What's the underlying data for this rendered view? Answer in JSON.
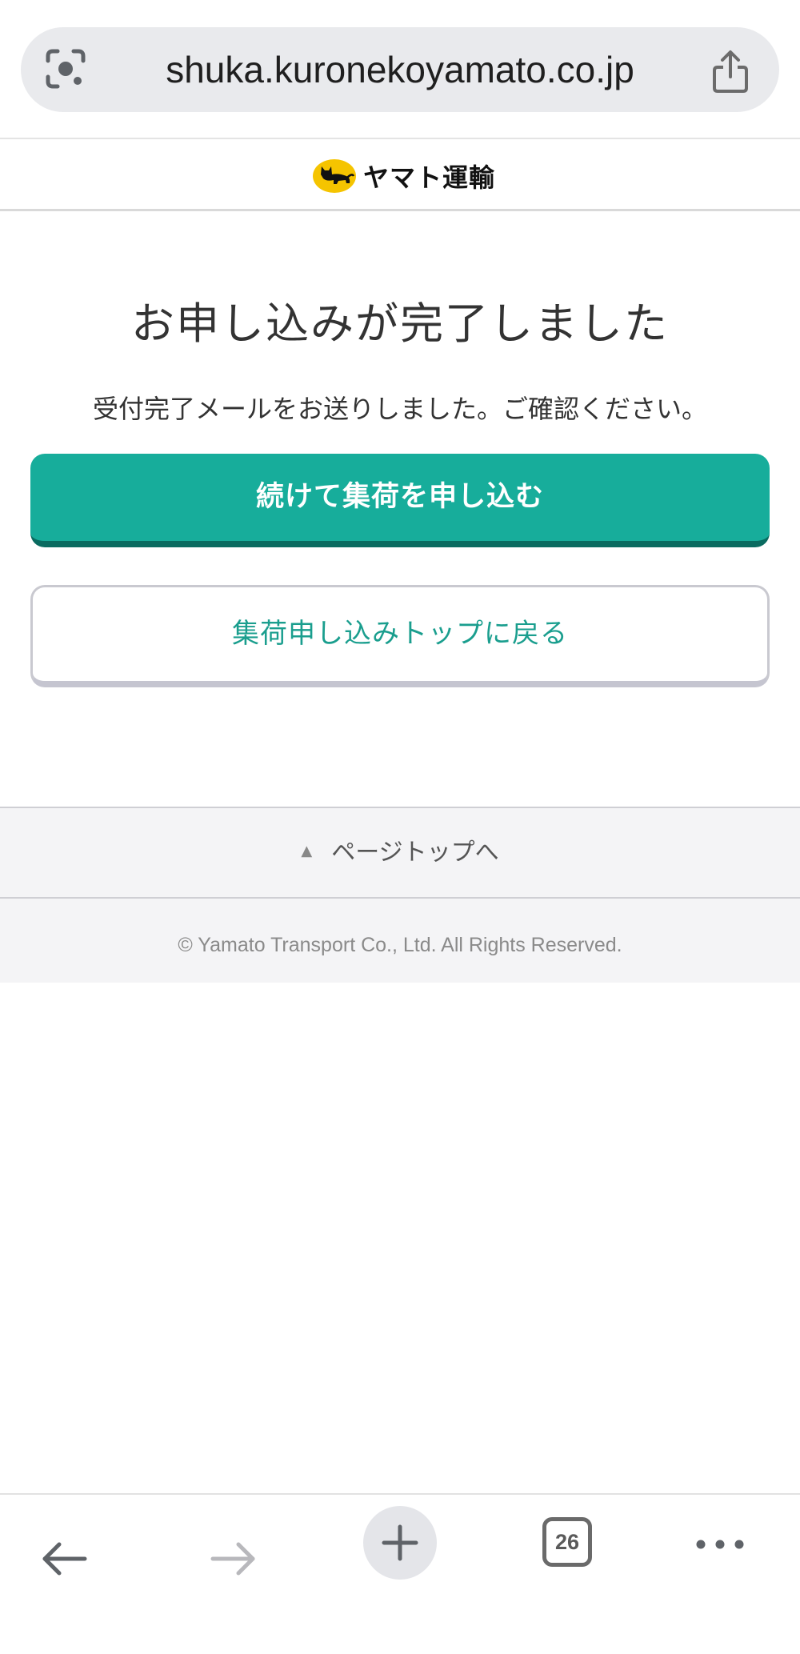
{
  "browser": {
    "url": "shuka.kuronekoyamato.co.jp",
    "tab_count": "26",
    "icons": {
      "lens": "google-lens-icon",
      "share": "share-icon",
      "back": "back-arrow-icon",
      "forward": "forward-arrow-icon",
      "new_tab": "plus-icon",
      "more": "more-dots-icon"
    }
  },
  "header": {
    "logo_text": "ヤマト運輸",
    "logo_icon": "black-cat-logo-icon"
  },
  "main": {
    "title": "お申し込みが完了しました",
    "message": "受付完了メールをお送りしました。ご確認ください。",
    "primary_button": "続けて集荷を申し込む",
    "secondary_button": "集荷申し込みトップに戻る"
  },
  "footer": {
    "pagetop_arrow": "▲",
    "pagetop_label": "ページトップへ",
    "copyright": "© Yamato Transport Co., Ltd. All Rights Reserved."
  },
  "colors": {
    "primary": "#17ad9b",
    "primary_shadow": "#0a6b60",
    "secondary_text": "#1a9e8e",
    "logo_yellow": "#f5c400"
  }
}
